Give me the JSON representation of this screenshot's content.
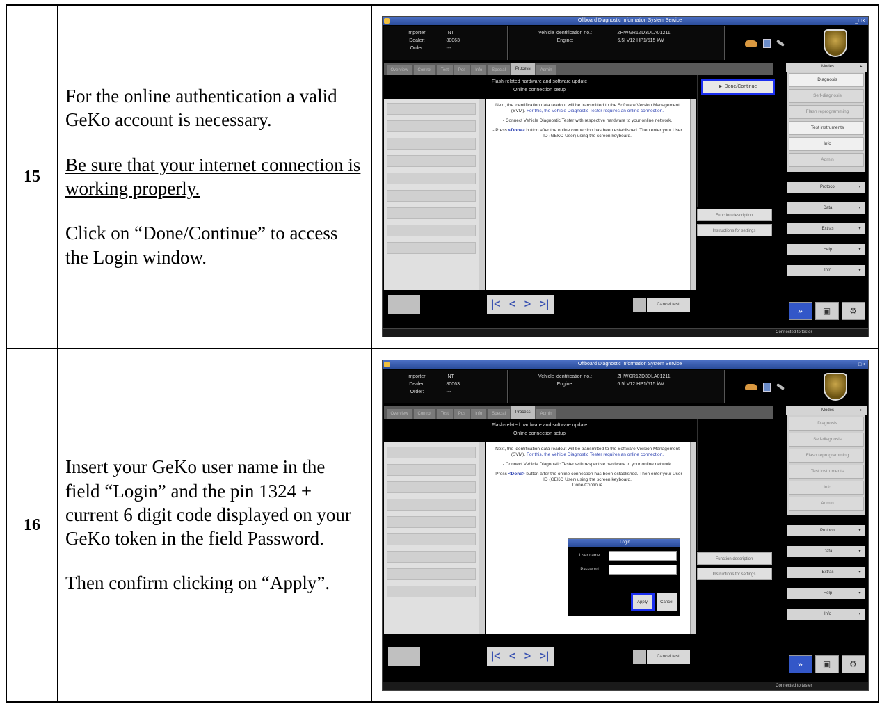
{
  "steps": [
    {
      "number": "15",
      "paragraphs": [
        "For the online authentication a valid GeKo account is necessary.",
        "Be sure that your internet connection is working properly.",
        "Click on “Done/Continue” to access the Login window."
      ]
    },
    {
      "number": "16",
      "paragraphs": [
        "Insert your GeKo user name in the field “Login” and the pin 1324 + current 6 digit code displayed on your GeKo token in the field Password.",
        "Then confirm clicking on “Apply”."
      ]
    }
  ],
  "screenshot": {
    "window_title": "Offboard Diagnostic Information System Service",
    "importer_label": "Importer:",
    "importer_value": "INT",
    "dealer_label": "Dealer:",
    "dealer_value": "80063",
    "order_label": "Order:",
    "order_value": "---",
    "vin_label": "Vehicle identification no.:",
    "vin_value": "ZHWGR1ZD3DLA01211",
    "engine_label": "Engine:",
    "engine_value": "6.5l V12 HP1/515 kW",
    "tabs": [
      "Overview",
      "Control",
      "Test",
      "Pos",
      "Info",
      "Special",
      "Process",
      "Admin"
    ],
    "active_tab": "Process",
    "header_line1": "Flash-related hardware and software update",
    "header_line2": "Online connection setup",
    "done_button": "Done/Continue",
    "content_p1": "Next, the identification data readout will be transmitted to the Software Version Management (SVM).",
    "content_p1b": "For this, the Vehicle Diagnostic Tester requires an online connection.",
    "content_p2": "- Connect Vehicle Diagnostic Tester with respective hardware to your online network.",
    "content_p3a": "- Press ",
    "content_p3_done": "<Done>",
    "content_p3b": " button after the online connection has been established. Then enter your User ID (GEKO User) using the screen keyboard.",
    "content_p4": "Done/Continue",
    "side_buttons": [
      "Function description",
      "Instructions for settings"
    ],
    "modes_label": "Modes",
    "mode_items": [
      "Diagnosis",
      "Self-diagnosis",
      "Flash reprogramming",
      "Test instruments",
      "Info",
      "Admin"
    ],
    "right_sections": [
      "Protocol",
      "Data",
      "Extras",
      "Help",
      "Info"
    ],
    "cancel_test": "Cancel test",
    "status_text": "Connected to tester",
    "login_title": "Login",
    "user_name_label": "User name",
    "password_label": "Password",
    "apply_label": "Apply",
    "cancel_label": "Cancel"
  }
}
